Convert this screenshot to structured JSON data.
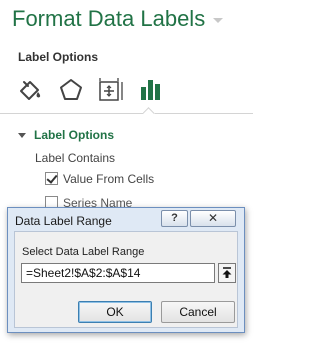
{
  "pane": {
    "title": "Format Data Labels",
    "section_label": "Label Options",
    "tabs": [
      {
        "icon": "fill-line-icon"
      },
      {
        "icon": "effects-icon"
      },
      {
        "icon": "size-properties-icon"
      },
      {
        "icon": "label-options-icon",
        "selected": true
      }
    ],
    "group": {
      "header": "Label Options",
      "expanded": true,
      "contains_label": "Label Contains",
      "options": [
        {
          "label": "Value From Cells",
          "checked": true
        },
        {
          "label": "Series Name",
          "checked": false
        }
      ]
    }
  },
  "dialog": {
    "title": "Data Label Range",
    "help_label": "?",
    "close_label": "✕",
    "prompt": "Select Data Label Range",
    "range_value": "=Sheet2!$A$2:$A$14",
    "ok_label": "OK",
    "cancel_label": "Cancel"
  },
  "colors": {
    "accent": "#217346",
    "dialog_frame": "#dfe9f5"
  }
}
